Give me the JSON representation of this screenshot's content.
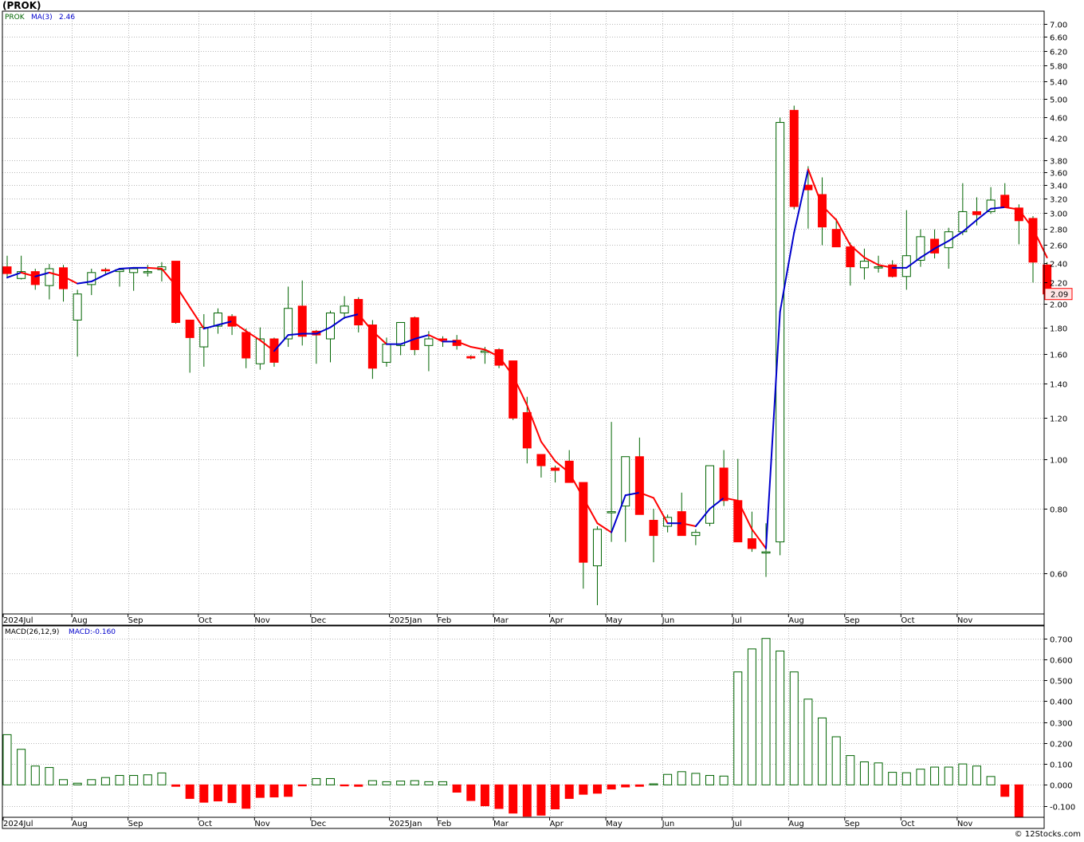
{
  "header": {
    "title": "(PROK)"
  },
  "footer": {
    "credit": "© 12Stocks.com"
  },
  "price_legend": {
    "ticker": "PROK",
    "ma_label": "MA(3)",
    "ma_value": "2.46"
  },
  "macd_legend": {
    "label": "MACD(26,12,9)",
    "value": "MACD:-0.160"
  },
  "last_price": "2.09",
  "colors": {
    "up": "#ffffff",
    "down": "#ff0000",
    "wick": "#006400",
    "ma_up": "#0000cc",
    "ma_down": "#ff0000",
    "macd_pos": "#006400",
    "macd_neg": "#ff0000"
  },
  "chart_data": [
    {
      "type": "candlestick",
      "title": "",
      "scale": "log",
      "ylim": [
        0.5,
        7.4
      ],
      "yticks": [
        "7.00",
        "6.60",
        "6.20",
        "5.80",
        "5.40",
        "5.00",
        "4.60",
        "4.20",
        "3.80",
        "3.60",
        "3.40",
        "3.20",
        "3.00",
        "2.80",
        "2.60",
        "2.40",
        "2.20",
        "2.00",
        "1.80",
        "1.60",
        "1.40",
        "1.20",
        "1.00",
        "0.80",
        "0.60"
      ],
      "xlabels": [
        "2024Jul",
        "Aug",
        "Sep",
        "Oct",
        "Nov",
        "Dec",
        "2025Jan",
        "Feb",
        "Mar",
        "Apr",
        "May",
        "Jun",
        "Jul",
        "Aug",
        "Sep",
        "Oct",
        "Nov"
      ],
      "candles": [
        [
          2.36,
          2.48,
          2.24,
          2.29
        ],
        [
          2.24,
          2.48,
          2.23,
          2.31
        ],
        [
          2.31,
          2.34,
          2.13,
          2.18
        ],
        [
          2.17,
          2.39,
          2.04,
          2.34
        ],
        [
          2.35,
          2.38,
          2.02,
          2.14
        ],
        [
          1.86,
          2.13,
          1.58,
          2.09
        ],
        [
          2.18,
          2.34,
          2.08,
          2.3
        ],
        [
          2.33,
          2.35,
          2.29,
          2.32
        ],
        [
          2.31,
          2.32,
          2.16,
          2.33
        ],
        [
          2.3,
          2.33,
          2.12,
          2.34
        ],
        [
          2.31,
          2.38,
          2.26,
          2.31
        ],
        [
          2.33,
          2.41,
          2.21,
          2.36
        ],
        [
          2.42,
          2.42,
          1.83,
          1.84
        ],
        [
          1.86,
          1.86,
          1.47,
          1.72
        ],
        [
          1.65,
          1.91,
          1.51,
          1.8
        ],
        [
          1.81,
          1.96,
          1.75,
          1.92
        ],
        [
          1.89,
          1.91,
          1.74,
          1.81
        ],
        [
          1.76,
          1.79,
          1.5,
          1.57
        ],
        [
          1.53,
          1.8,
          1.49,
          1.71
        ],
        [
          1.71,
          1.72,
          1.51,
          1.54
        ],
        [
          1.71,
          2.16,
          1.65,
          1.96
        ],
        [
          1.98,
          2.22,
          1.66,
          1.73
        ],
        [
          1.77,
          1.78,
          1.53,
          1.74
        ],
        [
          1.71,
          1.94,
          1.54,
          1.92
        ],
        [
          1.92,
          2.07,
          1.87,
          1.98
        ],
        [
          2.04,
          2.06,
          1.76,
          1.82
        ],
        [
          1.82,
          1.86,
          1.43,
          1.5
        ],
        [
          1.54,
          1.72,
          1.51,
          1.67
        ],
        [
          1.66,
          1.84,
          1.59,
          1.84
        ],
        [
          1.88,
          1.89,
          1.59,
          1.63
        ],
        [
          1.66,
          1.77,
          1.48,
          1.71
        ],
        [
          1.71,
          1.73,
          1.65,
          1.7
        ],
        [
          1.7,
          1.74,
          1.63,
          1.66
        ],
        [
          1.58,
          1.59,
          1.56,
          1.57
        ],
        [
          1.61,
          1.65,
          1.53,
          1.62
        ],
        [
          1.63,
          1.64,
          1.5,
          1.52
        ],
        [
          1.55,
          1.55,
          1.19,
          1.2
        ],
        [
          1.23,
          1.32,
          0.98,
          1.05
        ],
        [
          1.02,
          1.02,
          0.92,
          0.97
        ],
        [
          0.96,
          0.97,
          0.9,
          0.95
        ],
        [
          0.99,
          1.04,
          0.9,
          0.9
        ],
        [
          0.9,
          0.9,
          0.56,
          0.63
        ],
        [
          0.62,
          0.74,
          0.52,
          0.73
        ],
        [
          0.79,
          1.18,
          0.69,
          0.79
        ],
        [
          0.81,
          1.01,
          0.69,
          1.01
        ],
        [
          1.01,
          1.1,
          0.78,
          0.78
        ],
        [
          0.76,
          0.8,
          0.63,
          0.71
        ],
        [
          0.74,
          0.78,
          0.72,
          0.77
        ],
        [
          0.79,
          0.86,
          0.71,
          0.71
        ],
        [
          0.71,
          0.73,
          0.68,
          0.72
        ],
        [
          0.75,
          0.97,
          0.74,
          0.97
        ],
        [
          0.96,
          1.04,
          0.81,
          0.83
        ],
        [
          0.83,
          1.0,
          0.69,
          0.69
        ],
        [
          0.7,
          0.79,
          0.66,
          0.67
        ],
        [
          0.66,
          0.75,
          0.59,
          0.66
        ],
        [
          0.69,
          4.6,
          0.65,
          4.5
        ],
        [
          4.75,
          4.85,
          3.05,
          3.09
        ],
        [
          3.4,
          3.7,
          2.8,
          3.33
        ],
        [
          3.26,
          3.52,
          2.6,
          2.82
        ],
        [
          2.79,
          2.93,
          2.58,
          2.58
        ],
        [
          2.58,
          2.63,
          2.17,
          2.36
        ],
        [
          2.35,
          2.56,
          2.23,
          2.42
        ],
        [
          2.35,
          2.48,
          2.3,
          2.36
        ],
        [
          2.38,
          2.43,
          2.25,
          2.26
        ],
        [
          2.26,
          3.04,
          2.13,
          2.48
        ],
        [
          2.43,
          2.79,
          2.36,
          2.7
        ],
        [
          2.67,
          2.79,
          2.45,
          2.51
        ],
        [
          2.57,
          2.81,
          2.34,
          2.76
        ],
        [
          2.76,
          3.43,
          2.72,
          3.02
        ],
        [
          3.02,
          3.22,
          2.84,
          2.98
        ],
        [
          3.02,
          3.37,
          2.99,
          3.18
        ],
        [
          3.25,
          3.43,
          3.09,
          3.08
        ],
        [
          3.07,
          3.12,
          2.61,
          2.9
        ],
        [
          2.93,
          2.96,
          2.2,
          2.41
        ],
        [
          2.38,
          2.41,
          2.09,
          2.09
        ]
      ],
      "ma": [
        2.25,
        2.3,
        2.26,
        2.3,
        2.26,
        2.19,
        2.21,
        2.28,
        2.34,
        2.35,
        2.35,
        2.34,
        2.17,
        1.97,
        1.79,
        1.82,
        1.85,
        1.77,
        1.7,
        1.62,
        1.74,
        1.75,
        1.75,
        1.8,
        1.88,
        1.91,
        1.77,
        1.67,
        1.67,
        1.71,
        1.74,
        1.69,
        1.69,
        1.65,
        1.63,
        1.58,
        1.45,
        1.27,
        1.08,
        0.99,
        0.94,
        0.84,
        0.75,
        0.72,
        0.85,
        0.86,
        0.84,
        0.75,
        0.75,
        0.74,
        0.8,
        0.84,
        0.83,
        0.73,
        0.67,
        1.93,
        2.75,
        3.65,
        3.1,
        2.91,
        2.6,
        2.46,
        2.38,
        2.35,
        2.35,
        2.46,
        2.56,
        2.65,
        2.76,
        2.91,
        3.06,
        3.08,
        3.05,
        2.8,
        2.46
      ],
      "ma_colors": [
        "ma_down",
        "ma_up",
        "ma_down",
        "ma_up",
        "ma_down",
        "ma_down",
        "ma_up",
        "ma_up",
        "ma_up",
        "ma_up",
        "ma_up",
        "ma_down",
        "ma_down",
        "ma_down",
        "ma_down",
        "ma_up",
        "ma_up",
        "ma_down",
        "ma_down",
        "ma_down",
        "ma_up",
        "ma_up",
        "ma_up",
        "ma_up",
        "ma_up",
        "ma_up",
        "ma_down",
        "ma_down",
        "ma_up",
        "ma_up",
        "ma_up",
        "ma_down",
        "ma_up",
        "ma_down",
        "ma_down",
        "ma_down",
        "ma_down",
        "ma_down",
        "ma_down",
        "ma_down",
        "ma_down",
        "ma_down",
        "ma_down",
        "ma_down",
        "ma_up",
        "ma_up",
        "ma_down",
        "ma_down",
        "ma_up",
        "ma_down",
        "ma_up",
        "ma_up",
        "ma_down",
        "ma_down",
        "ma_down",
        "ma_up",
        "ma_up",
        "ma_up",
        "ma_down",
        "ma_down",
        "ma_down",
        "ma_down",
        "ma_down",
        "ma_down",
        "ma_up",
        "ma_up",
        "ma_up",
        "ma_up",
        "ma_up",
        "ma_up",
        "ma_up",
        "ma_up",
        "ma_down",
        "ma_down",
        "ma_down"
      ]
    },
    {
      "type": "bar",
      "title": "",
      "ylim": [
        -0.155,
        0.76
      ],
      "yticks": [
        "0.700",
        "0.600",
        "0.500",
        "0.400",
        "0.300",
        "0.200",
        "0.100",
        "0.000",
        "-0.100"
      ],
      "xlabels": [
        "2024Jul",
        "Aug",
        "Sep",
        "Oct",
        "Nov",
        "Dec",
        "2025Jan",
        "Feb",
        "Mar",
        "Apr",
        "May",
        "Jun",
        "Jul",
        "Aug",
        "Sep",
        "Oct",
        "Nov"
      ],
      "values": [
        0.24,
        0.17,
        0.09,
        0.083,
        0.025,
        0.008,
        0.025,
        0.035,
        0.045,
        0.045,
        0.048,
        0.057,
        -0.007,
        -0.065,
        -0.083,
        -0.077,
        -0.085,
        -0.112,
        -0.06,
        -0.058,
        -0.055,
        -0.005,
        0.03,
        0.03,
        -0.005,
        -0.007,
        0.02,
        0.015,
        0.018,
        0.02,
        0.015,
        0.015,
        -0.035,
        -0.075,
        -0.1,
        -0.113,
        -0.135,
        -0.15,
        -0.145,
        -0.115,
        -0.065,
        -0.045,
        -0.04,
        -0.02,
        -0.01,
        -0.007,
        0.005,
        0.05,
        0.063,
        0.055,
        0.045,
        0.042,
        0.54,
        0.65,
        0.7,
        0.64,
        0.54,
        0.41,
        0.32,
        0.23,
        0.14,
        0.11,
        0.105,
        0.06,
        0.058,
        0.075,
        0.085,
        0.085,
        0.1,
        0.09,
        0.04,
        -0.055,
        -0.16
      ]
    }
  ]
}
